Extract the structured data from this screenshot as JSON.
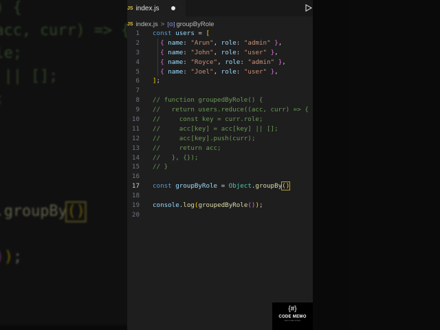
{
  "tab": {
    "icon": "JS",
    "filename": "index.js",
    "modified_icon": "unsaved-dot",
    "run_icon": "play-icon"
  },
  "breadcrumb": {
    "icon": "JS",
    "file": "index.js",
    "separator": ">",
    "symbol_icon": "[⊙]",
    "symbol": "groupByRole"
  },
  "active_line": 17,
  "lines": [
    [
      [
        "const ",
        "kw"
      ],
      [
        "users",
        "var"
      ],
      [
        " = ",
        "pl"
      ],
      [
        "[",
        "br1"
      ]
    ],
    [
      [
        "  ",
        "pl"
      ],
      [
        "{",
        "br2"
      ],
      [
        " name",
        "var"
      ],
      [
        ": ",
        "pl"
      ],
      [
        "\"Arun\"",
        "str"
      ],
      [
        ", ",
        "pl"
      ],
      [
        "role",
        "var"
      ],
      [
        ": ",
        "pl"
      ],
      [
        "\"admin\"",
        "str"
      ],
      [
        " ",
        "pl"
      ],
      [
        "}",
        "br2"
      ],
      [
        ",",
        "pl"
      ]
    ],
    [
      [
        "  ",
        "pl"
      ],
      [
        "{",
        "br2"
      ],
      [
        " name",
        "var"
      ],
      [
        ": ",
        "pl"
      ],
      [
        "\"John\"",
        "str"
      ],
      [
        ", ",
        "pl"
      ],
      [
        "role",
        "var"
      ],
      [
        ": ",
        "pl"
      ],
      [
        "\"user\"",
        "str"
      ],
      [
        " ",
        "pl"
      ],
      [
        "}",
        "br2"
      ],
      [
        ",",
        "pl"
      ]
    ],
    [
      [
        "  ",
        "pl"
      ],
      [
        "{",
        "br2"
      ],
      [
        " name",
        "var"
      ],
      [
        ": ",
        "pl"
      ],
      [
        "\"Royce\"",
        "str"
      ],
      [
        ", ",
        "pl"
      ],
      [
        "role",
        "var"
      ],
      [
        ": ",
        "pl"
      ],
      [
        "\"admin\"",
        "str"
      ],
      [
        " ",
        "pl"
      ],
      [
        "}",
        "br2"
      ],
      [
        ",",
        "pl"
      ]
    ],
    [
      [
        "  ",
        "pl"
      ],
      [
        "{",
        "br2"
      ],
      [
        " name",
        "var"
      ],
      [
        ": ",
        "pl"
      ],
      [
        "\"Joel\"",
        "str"
      ],
      [
        ", ",
        "pl"
      ],
      [
        "role",
        "var"
      ],
      [
        ": ",
        "pl"
      ],
      [
        "\"user\"",
        "str"
      ],
      [
        " ",
        "pl"
      ],
      [
        "}",
        "br2"
      ],
      [
        ",",
        "pl"
      ]
    ],
    [
      [
        "]",
        "br1"
      ],
      [
        ";",
        "pl"
      ]
    ],
    [],
    [
      [
        "// function groupedByRole() {",
        "cm"
      ]
    ],
    [
      [
        "//   return users.reduce((acc, curr) => {",
        "cm"
      ]
    ],
    [
      [
        "//     const key = curr.role;",
        "cm"
      ]
    ],
    [
      [
        "//     acc[key] = acc[key] || [];",
        "cm"
      ]
    ],
    [
      [
        "//     acc[key].push(curr);",
        "cm"
      ]
    ],
    [
      [
        "//     return acc;",
        "cm"
      ]
    ],
    [
      [
        "//   }, {});",
        "cm"
      ]
    ],
    [
      [
        "// }",
        "cm"
      ]
    ],
    [],
    [
      [
        "const ",
        "kw"
      ],
      [
        "groupByRole",
        "var"
      ],
      [
        " = ",
        "pl"
      ],
      [
        "Object",
        "cls"
      ],
      [
        ".",
        "pl"
      ],
      [
        "groupBy",
        "fn"
      ],
      [
        "()",
        "br1 hl"
      ]
    ],
    [],
    [
      [
        "console",
        "var"
      ],
      [
        ".",
        "pl"
      ],
      [
        "log",
        "fn"
      ],
      [
        "(",
        "br1"
      ],
      [
        "groupedByRole",
        "fn"
      ],
      [
        "()",
        "br2"
      ],
      [
        ")",
        "br1"
      ],
      [
        ";",
        "pl"
      ]
    ],
    []
  ],
  "watermark": {
    "glyph": "{#}",
    "name": "CODE MEMO",
    "tagline": "learn code simply"
  }
}
